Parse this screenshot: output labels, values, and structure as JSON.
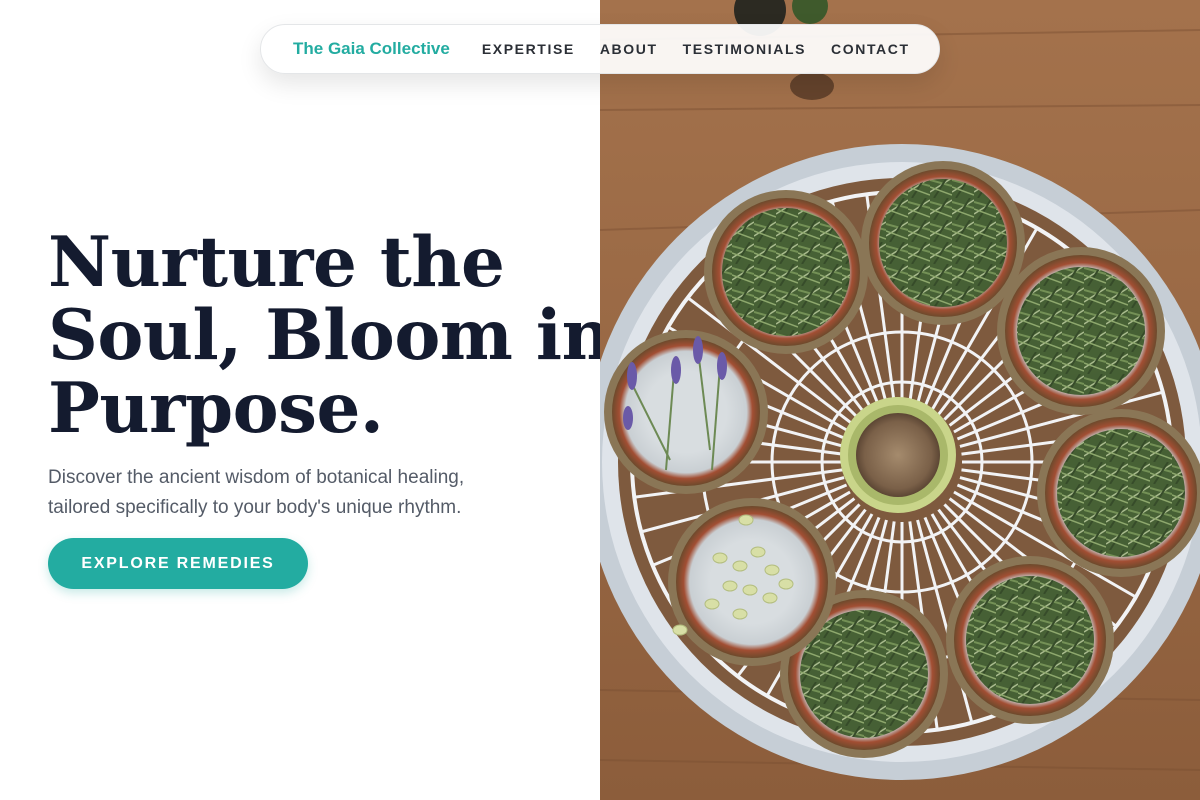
{
  "nav": {
    "brand": "The Gaia Collective",
    "links": [
      "EXPERTISE",
      "ABOUT",
      "TESTIMONIALS",
      "CONTACT"
    ]
  },
  "hero": {
    "headline_lines": [
      "Nurture the",
      "Soul, Bloom in",
      "Purpose."
    ],
    "subtext_lines": [
      "Discover the ancient wisdom of botanical healing,",
      "tailored specifically to your body's unique rhythm."
    ],
    "cta_label": "EXPLORE REMEDIES",
    "image_alt": "Drying rack with bowls of rosemary, lavender, seeds and a sunflower head"
  },
  "colors": {
    "accent": "#23aca1",
    "headline": "#141b2f",
    "body_text": "#545b67"
  }
}
